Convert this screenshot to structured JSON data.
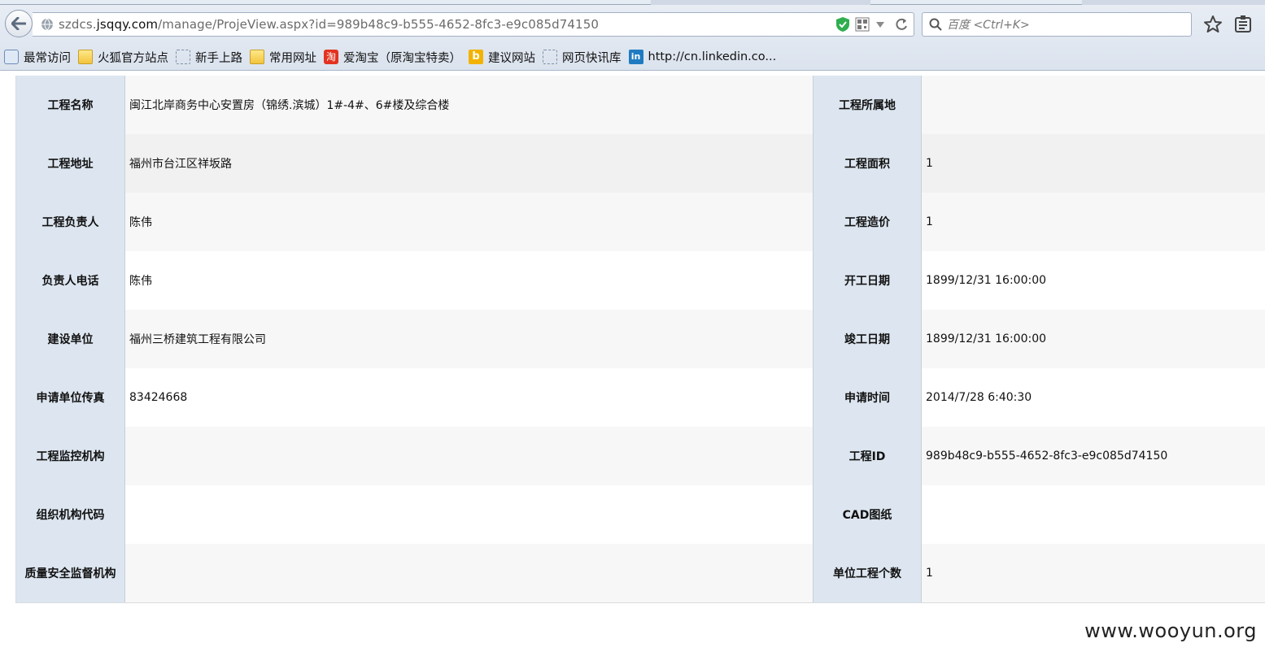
{
  "browser": {
    "url_prefix": "szdcs.",
    "url_domain": "jsqqy.com",
    "url_path": "/manage/ProjeView.aspx?id=989b48c9-b555-4652-8fc3-e9c085d74150",
    "search_placeholder": "百度 <Ctrl+K>",
    "bookmarks": [
      {
        "label": "最常访问",
        "icon": "magnifier-icon"
      },
      {
        "label": "火狐官方站点",
        "icon": "folder-icon"
      },
      {
        "label": "新手上路",
        "icon": "dashed-page-icon"
      },
      {
        "label": "常用网址",
        "icon": "folder-icon"
      },
      {
        "label": "爱淘宝（原淘宝特卖）",
        "icon": "taobao-icon",
        "glyph": "淘"
      },
      {
        "label": "建议网站",
        "icon": "bing-icon",
        "glyph": "b"
      },
      {
        "label": "网页快讯库",
        "icon": "dashed-page-icon"
      },
      {
        "label": "http://cn.linkedin.co...",
        "icon": "linkedin-icon",
        "glyph": "in"
      }
    ]
  },
  "table": {
    "rows": [
      {
        "l1": "工程名称",
        "v1": "闽江北岸商务中心安置房（锦绣.滨城）1#-4#、6#楼及综合楼",
        "l2": "工程所属地",
        "v2": ""
      },
      {
        "l1": "工程地址",
        "v1": "福州市台江区祥坂路",
        "l2": "工程面积",
        "v2": "1"
      },
      {
        "l1": "工程负责人",
        "v1": "陈伟",
        "l2": "工程造价",
        "v2": "1"
      },
      {
        "l1": "负责人电话",
        "v1": "陈伟",
        "l2": "开工日期",
        "v2": "1899/12/31 16:00:00"
      },
      {
        "l1": "建设单位",
        "v1": "福州三桥建筑工程有限公司",
        "l2": "竣工日期",
        "v2": "1899/12/31 16:00:00"
      },
      {
        "l1": "申请单位传真",
        "v1": "83424668",
        "l2": "申请时间",
        "v2": "2014/7/28 6:40:30"
      },
      {
        "l1": "工程监控机构",
        "v1": "",
        "l2": "工程ID",
        "v2": "989b48c9-b555-4652-8fc3-e9c085d74150"
      },
      {
        "l1": "组织机构代码",
        "v1": "",
        "l2": "CAD图纸",
        "v2": ""
      },
      {
        "l1": "质量安全监督机构",
        "v1": "",
        "l2": "单位工程个数",
        "v2": "1"
      }
    ]
  },
  "watermark": "www.wooyun.org"
}
